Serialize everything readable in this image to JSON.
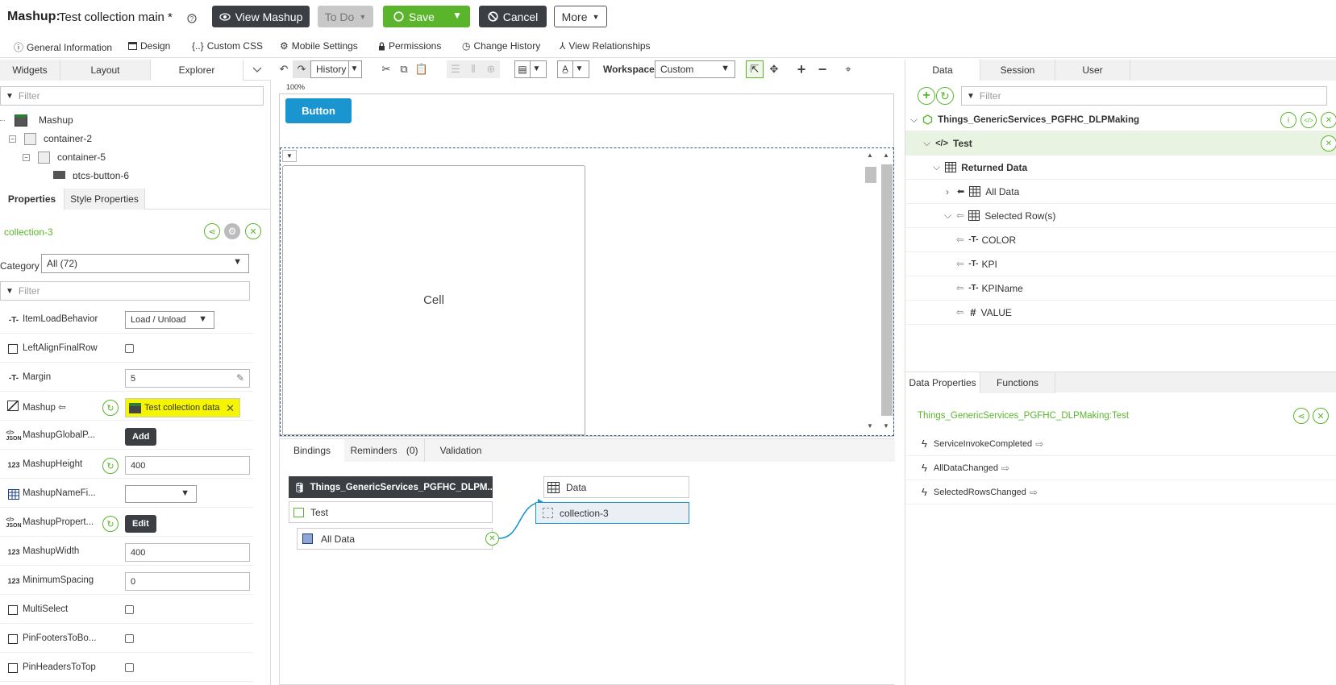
{
  "header": {
    "label": "Mashup:",
    "title": "Test collection main *",
    "help_icon": "help-circle-icon",
    "view_mashup": "View Mashup",
    "todo": "To Do",
    "save": "Save",
    "cancel": "Cancel",
    "more": "More"
  },
  "topnav": {
    "items": [
      "General Information",
      "Design",
      "Custom CSS",
      "Mobile Settings",
      "Permissions",
      "Change History",
      "View Relationships"
    ]
  },
  "left": {
    "tabs": [
      "Widgets",
      "Layout",
      "Explorer"
    ],
    "filter_placeholder": "Filter",
    "tree": [
      "Mashup",
      "container-2",
      "container-5",
      "ptcs-button-6"
    ],
    "prop_tabs": [
      "Properties",
      "Style Properties"
    ],
    "selected_widget": "collection-3",
    "category_label": "Category",
    "category_value": "All (72)",
    "props": [
      {
        "name": "ItemLoadBehavior",
        "icon": "T",
        "value": "Load / Unload"
      },
      {
        "name": "LeftAlignFinalRow",
        "icon": "chk"
      },
      {
        "name": "Margin",
        "icon": "T",
        "value": "5"
      },
      {
        "name": "Mashup ⇦",
        "icon": "mash",
        "value": "Test collection data"
      },
      {
        "name": "MashupGlobalP...",
        "icon": "JSON",
        "button": "Add"
      },
      {
        "name": "MashupHeight",
        "icon": "123",
        "value": "400"
      },
      {
        "name": "MashupNameFi...",
        "icon": "table"
      },
      {
        "name": "MashupPropert...",
        "icon": "JSON",
        "button": "Edit"
      },
      {
        "name": "MashupWidth",
        "icon": "123",
        "value": "400"
      },
      {
        "name": "MinimumSpacing",
        "icon": "123",
        "value": "0"
      },
      {
        "name": "MultiSelect",
        "icon": "chk"
      },
      {
        "name": "PinFootersToBo...",
        "icon": "chk"
      },
      {
        "name": "PinHeadersToTop",
        "icon": "chk"
      }
    ]
  },
  "center": {
    "history": "History",
    "workspace_label": "Workspace",
    "workspace_value": "Custom",
    "zoom": "100%",
    "button_label": "Button",
    "cell_label": "Cell",
    "bottom_tabs": {
      "bindings": "Bindings",
      "reminders": "Reminders",
      "reminders_count": "(0)",
      "validation": "Validation"
    },
    "binding": {
      "source": "Things_GenericServices_PGFHC_DLPM...",
      "service": "Test",
      "output": "All Data",
      "target_prop": "Data",
      "target_widget": "collection-3"
    }
  },
  "right": {
    "tabs": [
      "Data",
      "Session",
      "User"
    ],
    "filter_placeholder": "Filter",
    "thing": "Things_GenericServices_PGFHC_DLPMaking",
    "service": "Test",
    "returned": "Returned Data",
    "all_data": "All Data",
    "selected_rows": "Selected Row(s)",
    "fields": [
      {
        "name": "COLOR",
        "type": "T"
      },
      {
        "name": "KPI",
        "type": "T"
      },
      {
        "name": "KPIName",
        "type": "T"
      },
      {
        "name": "VALUE",
        "type": "#"
      }
    ],
    "bottom_tabs": [
      "Data Properties",
      "Functions"
    ],
    "dp_title": "Things_GenericServices_PGFHC_DLPMaking:Test",
    "events": [
      "ServiceInvokeCompleted",
      "AllDataChanged",
      "SelectedRowsChanged"
    ]
  },
  "colors": {
    "green": "#5ab52c",
    "blue_btn": "#1a95d0",
    "dark": "#3b3f44",
    "highlight": "#f5f500"
  }
}
